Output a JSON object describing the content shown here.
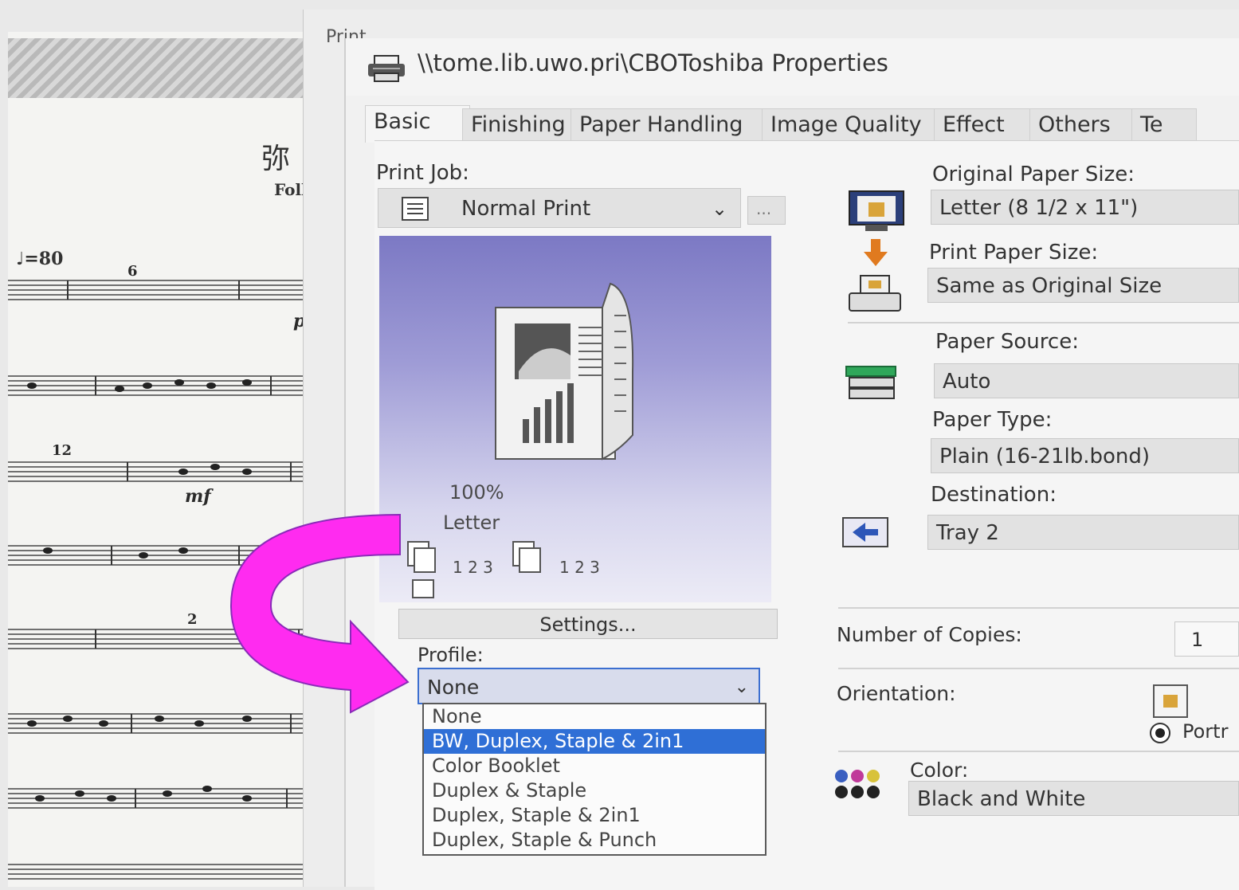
{
  "sheet": {
    "title": "弥",
    "subtitle": "Foll",
    "tempo": "♩=80",
    "measure_6": "6",
    "measure_12": "12",
    "measure_2": "2",
    "dyn_p": "p",
    "dyn_mf": "mf"
  },
  "print_window": {
    "title": "Print"
  },
  "dialog": {
    "title": "\\\\tome.lib.uwo.pri\\CBOToshiba Properties",
    "tabs": [
      "Basic",
      "Finishing",
      "Paper Handling",
      "Image Quality",
      "Effect",
      "Others",
      "Te"
    ],
    "active_tab": "Basic"
  },
  "basic": {
    "print_job_label": "Print Job:",
    "print_job_value": "Normal Print",
    "more_button": "...",
    "preview_zoom": "100%",
    "preview_paper": "Letter",
    "collate_1": "1 2 3",
    "collate_2": "1 2 3",
    "settings_button": "Settings...",
    "profile_label": "Profile:",
    "profile_value": "None",
    "profile_options": [
      "None",
      "BW, Duplex, Staple & 2in1",
      "Color Booklet",
      "Duplex & Staple",
      "Duplex, Staple & 2in1",
      "Duplex, Staple & Punch"
    ],
    "profile_highlighted": "BW, Duplex, Staple & 2in1",
    "original_paper_size_label": "Original Paper Size:",
    "original_paper_size_value": "Letter (8 1/2 x 11\")",
    "print_paper_size_label": "Print Paper Size:",
    "print_paper_size_value": "Same as Original Size",
    "paper_source_label": "Paper Source:",
    "paper_source_value": "Auto",
    "paper_type_label": "Paper Type:",
    "paper_type_value": "Plain (16-21lb.bond)",
    "destination_label": "Destination:",
    "destination_value": "Tray 2",
    "copies_label": "Number of Copies:",
    "copies_value": "1",
    "orientation_label": "Orientation:",
    "orientation_value": "Portr",
    "color_label": "Color:",
    "color_value": "Black and White"
  },
  "colors": {
    "annotation_arrow": "#ff33ff",
    "selection": "#2f6fd6",
    "preview_gradient_top": "#7c79c4"
  },
  "icons": [
    "printer-icon",
    "document-icon",
    "dropdown-chevron-icon",
    "paper-size-icon",
    "down-arrow-icon",
    "print-size-icon",
    "paper-tray-icon",
    "destination-icon",
    "portrait-icon",
    "color-dots-icon",
    "curved-arrow-icon"
  ]
}
